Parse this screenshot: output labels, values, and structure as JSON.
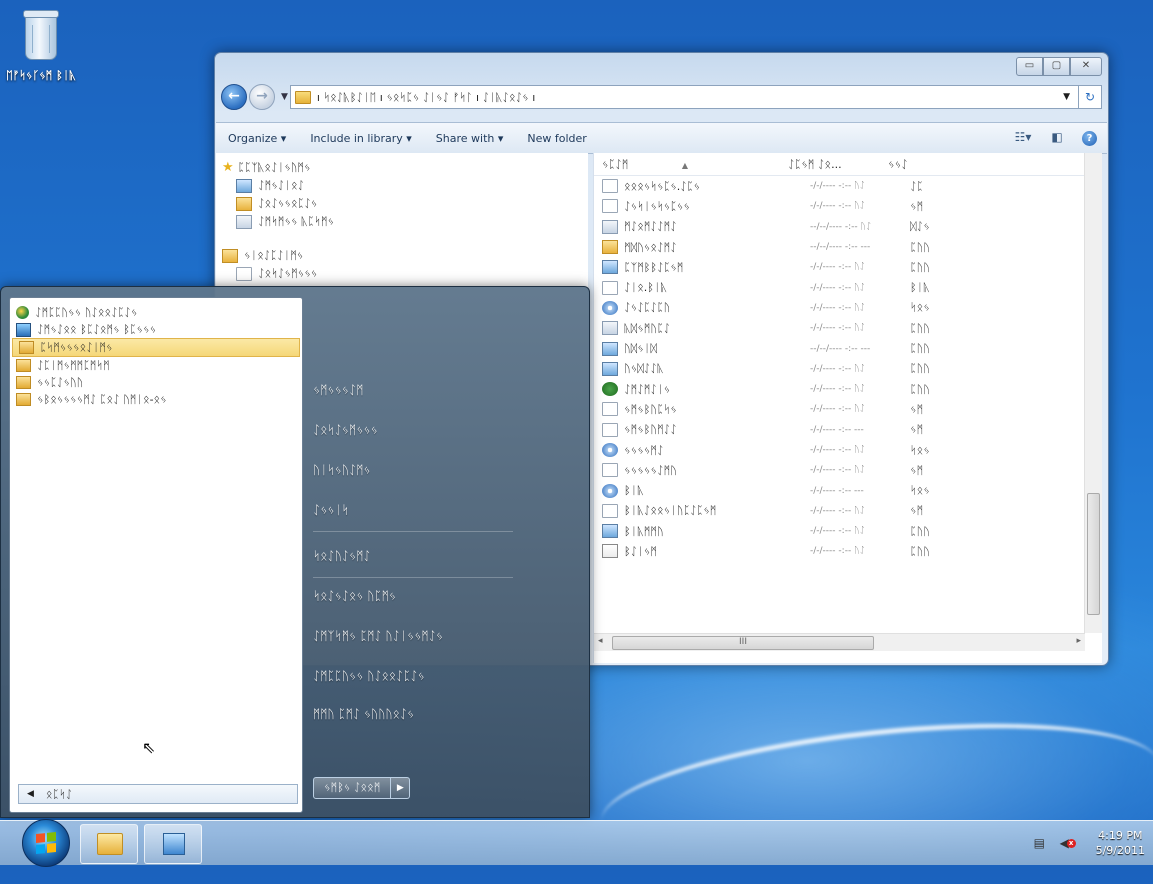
{
  "desktop": {
    "recycle_bin_label": "ᛖᚠᛋᛃᚴᛃᛗ ᛒᛁᚣ"
  },
  "explorer": {
    "caption_min": "▭",
    "caption_max": "▢",
    "caption_close": "✕",
    "address_path": "ı ᛋᛟᛇᚣᛒᛇᛁᛖ ı ᛃᛟᛋᛈᛃ ᛇᛁᛃᛇ ᚠᛋᛚ ı ᛇᛁᚣᛇᛟᛇᛃ ı",
    "toolbar": {
      "organize": "Organize ▾",
      "include_library": "Include in library ▾",
      "share_with": "Share with ▾",
      "new_folder": "New folder"
    },
    "nav_pane": {
      "favorites": "ᛈᛈᛉᚣᛟᛇᛁᛃᚢᛗᛃ",
      "favorites_items": [
        "ᛇᛗᛃᛇᛁᛟᛇ",
        "ᛇᛟᛇᛃᛃᛟᛈᛇᛃ",
        "ᛇᛗᛋᛗᛃᛃ ᚣᛈᛋᛗᛃ"
      ],
      "libraries": "ᛃᛁᛟᛇᛈᛇᛁᛗᛃ",
      "libraries_items": [
        "ᛇᛟᛋᛇᛃᛗᛃᛃᛃ"
      ]
    },
    "columns": {
      "name": "ᛃᛈᛇᛗ",
      "date": "ᛇᛈᛃᛗ ᛇᛟ...",
      "type": "ᛃᛃᛇ"
    },
    "files": [
      {
        "name": "ᛟᛟᛟᛃᛋᛃᛈᛃ.ᛇᛈᛃ",
        "date": "-/-/---- -:-- ᚢᛇ",
        "type": "ᛇᛈ",
        "icon": "file"
      },
      {
        "name": "ᛇᛃᛋᛁᛃᛋᛃᛈᛃᛃ",
        "date": "-/-/---- -:-- ᚢᛇ",
        "type": "ᛃᛗ",
        "icon": "file"
      },
      {
        "name": "ᛗᛇᛟᛗᛇᛇᛗᛇ",
        "date": "--/--/---- -:-- ᚢᛇ",
        "type": "ᛞᛇᛃ",
        "icon": "exe"
      },
      {
        "name": "ᛗᛞᚢᛃᛟᛇᛗᛇ",
        "date": "--/--/---- -:-- ---",
        "type": "ᛈᚢᚢ",
        "icon": "folder"
      },
      {
        "name": "ᛈᛉᛗᛒᛒᛇᛈᛃᛗ",
        "date": "-/-/---- -:-- ᚢᛇ",
        "type": "ᛈᚢᚢ",
        "icon": "img"
      },
      {
        "name": "ᛇᛁᛟ.ᛒᛁᚣ",
        "date": "-/-/---- -:-- ᚢᛇ",
        "type": "ᛒᛁᚣ",
        "icon": "file"
      },
      {
        "name": "ᛇᛃᛇᛈᛇᛈᚢ",
        "date": "-/-/---- -:-- ᚢᛇ",
        "type": "ᛋᛟᛃ",
        "icon": "cd"
      },
      {
        "name": "ᚣᛞᛃᛗᚢᛈᛇ",
        "date": "-/-/---- -:-- ᚢᛇ",
        "type": "ᛈᚢᚢ",
        "icon": "exe"
      },
      {
        "name": "ᚢᛞᛃᛁᛞ",
        "date": "--/--/---- -:-- ---",
        "type": "ᛈᚢᚢ",
        "icon": "img"
      },
      {
        "name": "ᚢᛃᛞᛇᛇᚣ",
        "date": "-/-/---- -:-- ᚢᛇ",
        "type": "ᛈᚢᚢ",
        "icon": "img"
      },
      {
        "name": "ᛇᛗᛇᛗᛇᛁᛃ",
        "date": "-/-/---- -:-- ᚢᛇ",
        "type": "ᛈᚢᚢ",
        "icon": "gear"
      },
      {
        "name": "ᛃᛗᛃᛒᚢᛈᛋᛃ",
        "date": "-/-/---- -:-- ᚢᛇ",
        "type": "ᛃᛗ",
        "icon": "file"
      },
      {
        "name": "ᛃᛗᛃᛒᚢᛗᛇᛇ",
        "date": "-/-/---- -:-- ---",
        "type": "ᛃᛗ",
        "icon": "file"
      },
      {
        "name": "ᛃᛃᛃᛃᛗᛇ",
        "date": "-/-/---- -:-- ᚢᛇ",
        "type": "ᛋᛟᛃ",
        "icon": "cd"
      },
      {
        "name": "ᛃᛃᛃᛃᛃᛇᛗᚢ",
        "date": "-/-/---- -:-- ᚢᛇ",
        "type": "ᛃᛗ",
        "icon": "file"
      },
      {
        "name": "ᛒᛁᚣ",
        "date": "-/-/---- -:-- ---",
        "type": "ᛋᛟᛃ",
        "icon": "cd"
      },
      {
        "name": "ᛒᛁᚣᛇᛟᛟᛃᛁᚢᛈᛇᛈᛃᛗ",
        "date": "-/-/---- -:-- ᚢᛇ",
        "type": "ᛃᛗ",
        "icon": "file"
      },
      {
        "name": "ᛒᛁᚣᛗᛗᚢ",
        "date": "-/-/---- -:-- ᚢᛇ",
        "type": "ᛈᚢᚢ",
        "icon": "img"
      },
      {
        "name": "ᛒᛇᛁᛃᛗ",
        "date": "-/-/---- -:-- ᚢᛇ",
        "type": "ᛈᚢᚢ",
        "icon": "note"
      }
    ],
    "hscroll_label": "III"
  },
  "start_menu": {
    "programs": [
      {
        "label": "ᛇᛗᛈᛈᚢᛃᛃ ᚢᛇᛟᛟᛇᛈᛇᛃ",
        "icon": "ie"
      },
      {
        "label": "ᛇᛗᛃᛇᛟᛟ ᛒᛈᛇᛟᛗᛃ ᛒᛈᛃᛃᛃ",
        "icon": "pc"
      },
      {
        "label": "ᛈᛋᛗᛃᛃᛃᛟᛇᛁᛗᛃ",
        "icon": "folder",
        "selected": true
      },
      {
        "label": "ᛇᛈᛁᛗᛃᛗᛗᛈᛗᛋᛗ",
        "icon": "folder"
      },
      {
        "label": "ᛃᛃᛈᛇᛃᚢᚢ",
        "icon": "folder"
      },
      {
        "label": "ᛃᛒᛟᛃᛃᛃᛃᛗᛇ ᛈᛟᛇ ᚢᛗᛁᛟ-ᛟᛃ",
        "icon": "folder"
      }
    ],
    "back_label": "ᛟᛈᛋᛇ",
    "right_items": [
      "ᛃᛗᛃᛃᛃᛇᛗ",
      "ᛇᛟᛋᛇᛃᛗᛃᛃᛃ",
      "ᚢᛁᛋᛃᚢᛇᛗᛃ",
      "ᛇᛃᛃᛁᛋ",
      "ᛋᛟᛇᚢᛇᛃᛗᛇ",
      "ᛋᛟᛇᛃᛇᛟᛃ ᚢᛈᛗᛃ",
      "ᛇᛗᛉᛋᛗᛃ ᛈᛗᛇ ᚢᛇᛁᛃᛃᛗᛇᛃ",
      "ᛇᛗᛈᛈᚢᛃᛃ ᚢᛇᛟᛟᛇᛈᛇᛃ",
      "ᛗᛗᚢ ᛈᛗᛇ ᛃᚢᚢᚢᛟᛇᛃ"
    ],
    "shutdown_label": "ᛃᛗᛒᛃ ᛇᛟᛟᛗ"
  },
  "taskbar": {
    "clock_time": "4:19 PM",
    "clock_date": "5/9/2011"
  }
}
